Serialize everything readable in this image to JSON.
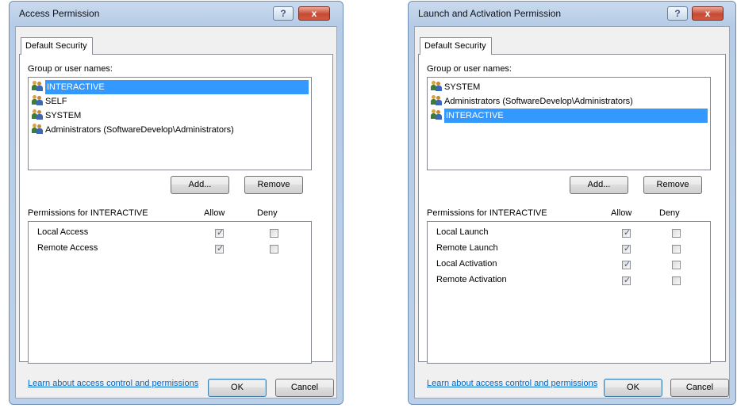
{
  "dialog_access": {
    "title": "Access Permission",
    "tab_label": "Default Security",
    "group_label": "Group or user names:",
    "users": [
      {
        "name": "INTERACTIVE",
        "selected": true
      },
      {
        "name": "SELF",
        "selected": false
      },
      {
        "name": "SYSTEM",
        "selected": false
      },
      {
        "name": "Administrators (SoftwareDevelop\\Administrators)",
        "selected": false
      }
    ],
    "add_label": "Add...",
    "remove_label": "Remove",
    "permissions_label": "Permissions for INTERACTIVE",
    "allow_header": "Allow",
    "deny_header": "Deny",
    "permissions": [
      {
        "name": "Local Access",
        "allow": true,
        "deny": false
      },
      {
        "name": "Remote Access",
        "allow": true,
        "deny": false
      }
    ],
    "link": "Learn about access control and permissions",
    "ok_label": "OK",
    "cancel_label": "Cancel",
    "help_glyph": "?",
    "close_glyph": "x"
  },
  "dialog_launch": {
    "title": "Launch and Activation Permission",
    "tab_label": "Default Security",
    "group_label": "Group or user names:",
    "users": [
      {
        "name": "SYSTEM",
        "selected": false
      },
      {
        "name": "Administrators (SoftwareDevelop\\Administrators)",
        "selected": false
      },
      {
        "name": "INTERACTIVE",
        "selected": true
      }
    ],
    "add_label": "Add...",
    "remove_label": "Remove",
    "permissions_label": "Permissions for INTERACTIVE",
    "allow_header": "Allow",
    "deny_header": "Deny",
    "permissions": [
      {
        "name": "Local Launch",
        "allow": true,
        "deny": false
      },
      {
        "name": "Remote Launch",
        "allow": true,
        "deny": false
      },
      {
        "name": "Local Activation",
        "allow": true,
        "deny": false
      },
      {
        "name": "Remote Activation",
        "allow": true,
        "deny": false
      }
    ],
    "link": "Learn about access control and permissions",
    "ok_label": "OK",
    "cancel_label": "Cancel",
    "help_glyph": "?",
    "close_glyph": "x"
  },
  "colors": {
    "selection": "#3399ff",
    "link": "#0066cc",
    "titlebar": "#c9daee",
    "close_button": "#c74a33"
  },
  "icons": {
    "user_group": "user-group-icon",
    "help": "help-icon",
    "close": "close-icon"
  }
}
